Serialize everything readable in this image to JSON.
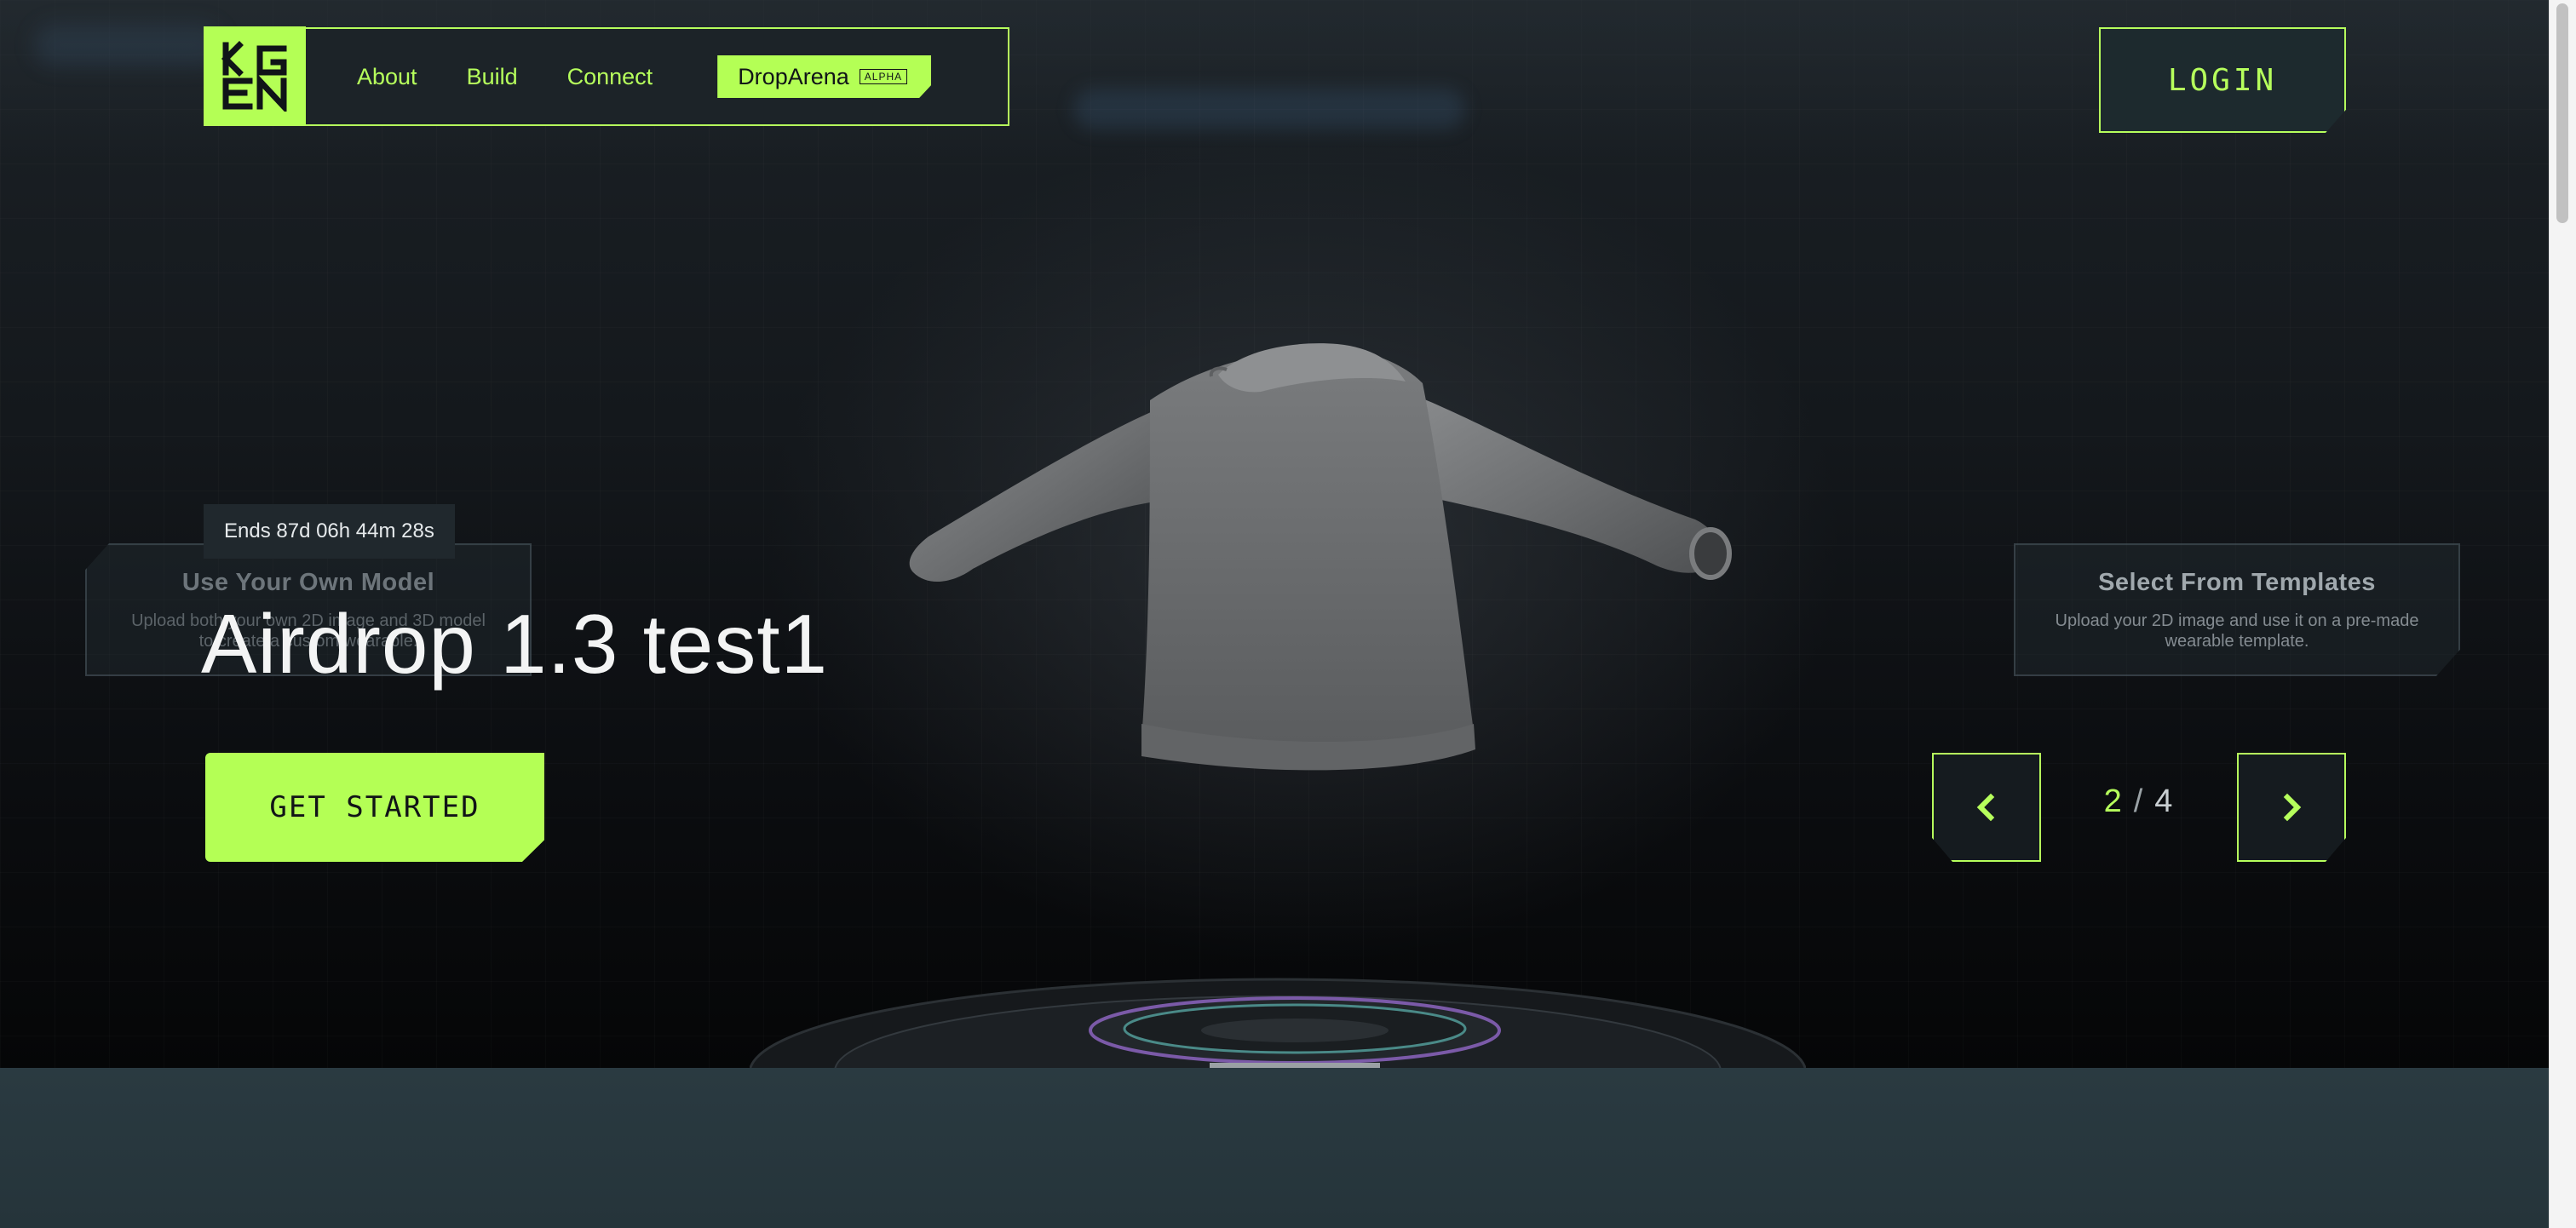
{
  "nav": {
    "links": [
      "About",
      "Build",
      "Connect"
    ],
    "drop_label": "DropArena",
    "drop_badge": "ALPHA"
  },
  "login_label": "LOGIN",
  "panels": {
    "left": {
      "title": "Use Your Own Model",
      "desc": "Upload both your own 2D image and 3D model to create a custom wearable."
    },
    "right": {
      "title": "Select From Templates",
      "desc": "Upload your 2D image and use it on a pre-made wearable template."
    }
  },
  "hero": {
    "countdown": "Ends 87d 06h 44m 28s",
    "title": "Airdrop 1.3 test1",
    "cta": "GET STARTED"
  },
  "carousel": {
    "current": "2",
    "separator": "/",
    "total": "4"
  },
  "colors": {
    "accent": "#b4ff55",
    "background": "#0c0e11"
  },
  "icons": [
    "kgen-logo-icon",
    "chevron-left-icon",
    "chevron-right-icon"
  ]
}
